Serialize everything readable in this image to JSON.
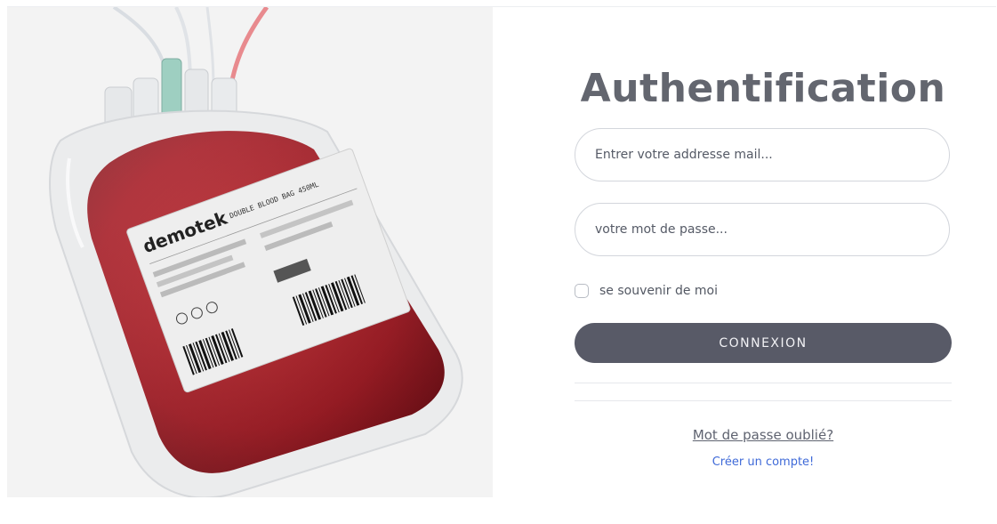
{
  "image": {
    "name": "blood-bag-photo",
    "brand": "demotek",
    "product": "DOUBLE BLOOD BAG 450ML"
  },
  "auth": {
    "title": "Authentification",
    "email_placeholder": "Entrer votre addresse mail...",
    "password_placeholder": "votre mot de passe...",
    "remember_label": "se souvenir de moi",
    "remember_checked": false,
    "submit_label": "CONNEXION",
    "forgot_link": "Mot de passe oublié?",
    "create_link": "Créer un compte!"
  },
  "colors": {
    "title": "#63666f",
    "button_bg": "#585a67",
    "link_create": "#3f6ad8",
    "blood": "#b4141e"
  }
}
